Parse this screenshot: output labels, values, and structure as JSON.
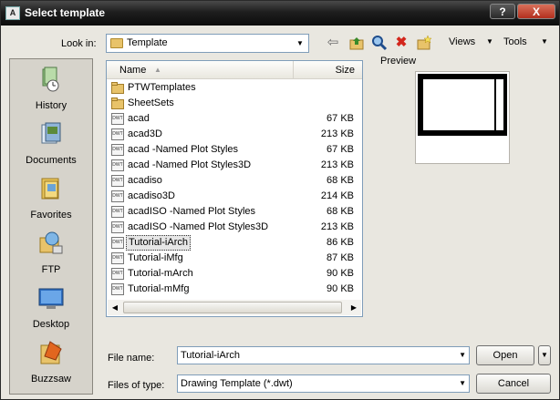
{
  "window": {
    "title": "Select template",
    "app_icon_text": "A",
    "help_label": "?",
    "close_label": "X"
  },
  "toolbar": {
    "look_in_label": "Look in:",
    "look_in_value": "Template",
    "views_label": "Views",
    "tools_label": "Tools"
  },
  "places": [
    {
      "label": "History",
      "icon": "history-icon"
    },
    {
      "label": "Documents",
      "icon": "documents-icon"
    },
    {
      "label": "Favorites",
      "icon": "favorites-icon"
    },
    {
      "label": "FTP",
      "icon": "ftp-icon"
    },
    {
      "label": "Desktop",
      "icon": "desktop-icon"
    },
    {
      "label": "Buzzsaw",
      "icon": "buzzsaw-icon"
    }
  ],
  "file_list": {
    "columns": {
      "name": "Name",
      "size": "Size"
    },
    "rows": [
      {
        "name": "PTWTemplates",
        "size": "",
        "type": "folder"
      },
      {
        "name": "SheetSets",
        "size": "",
        "type": "folder"
      },
      {
        "name": "acad",
        "size": "67 KB",
        "type": "dwt"
      },
      {
        "name": "acad3D",
        "size": "213 KB",
        "type": "dwt"
      },
      {
        "name": "acad -Named Plot Styles",
        "size": "67 KB",
        "type": "dwt"
      },
      {
        "name": "acad -Named Plot Styles3D",
        "size": "213 KB",
        "type": "dwt"
      },
      {
        "name": "acadiso",
        "size": "68 KB",
        "type": "dwt"
      },
      {
        "name": "acadiso3D",
        "size": "214 KB",
        "type": "dwt"
      },
      {
        "name": "acadISO -Named Plot Styles",
        "size": "68 KB",
        "type": "dwt"
      },
      {
        "name": "acadISO -Named Plot Styles3D",
        "size": "213 KB",
        "type": "dwt"
      },
      {
        "name": "Tutorial-iArch",
        "size": "86 KB",
        "type": "dwt",
        "selected": true
      },
      {
        "name": "Tutorial-iMfg",
        "size": "87 KB",
        "type": "dwt"
      },
      {
        "name": "Tutorial-mArch",
        "size": "90 KB",
        "type": "dwt"
      },
      {
        "name": "Tutorial-mMfg",
        "size": "90 KB",
        "type": "dwt"
      }
    ],
    "dwg_icon_text": "DWT"
  },
  "preview": {
    "label": "Preview"
  },
  "bottom": {
    "file_name_label": "File name:",
    "file_name_value": "Tutorial-iArch",
    "file_type_label": "Files of type:",
    "file_type_value": "Drawing Template (*.dwt)",
    "open_label": "Open",
    "cancel_label": "Cancel"
  }
}
